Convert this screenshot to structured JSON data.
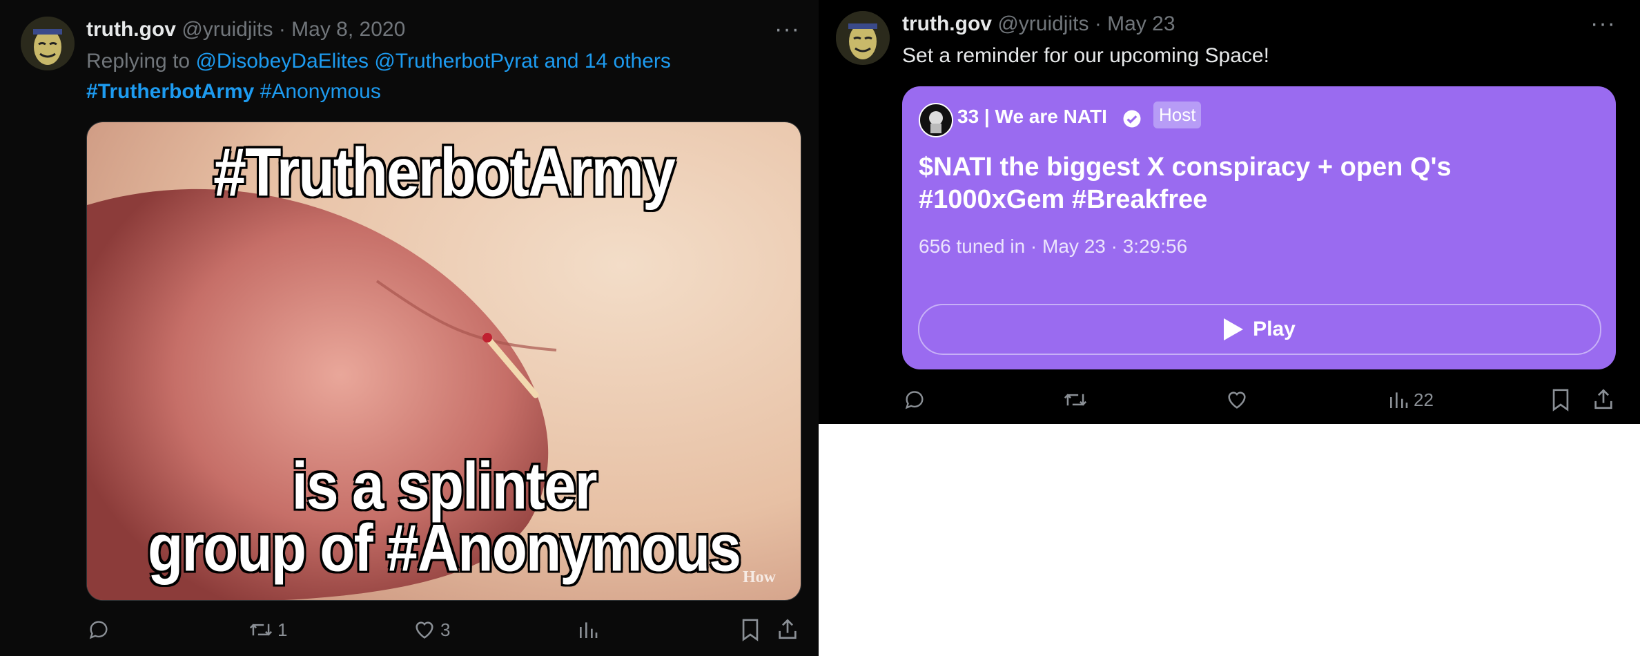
{
  "left_tweet": {
    "display_name": "truth.gov",
    "handle": "@yruidjits",
    "separator": "·",
    "date": "May 8, 2020",
    "replying_prefix": "Replying to",
    "replying_to": [
      "@DisobeyDaElites",
      "@TrutherbotPyrat",
      "and 14 others"
    ],
    "hashtags": [
      "#TrutherbotArmy",
      "#Anonymous"
    ],
    "image": {
      "top_text": "#TrutherbotArmy",
      "bottom_line1": "is a splinter",
      "bottom_line2": "group of #Anonymous",
      "watermark": "How"
    },
    "actions": {
      "reply_count": "",
      "retweet_count": "1",
      "like_count": "3",
      "views_count": ""
    }
  },
  "right_tweet": {
    "display_name": "truth.gov",
    "handle": "@yruidjits",
    "separator": "·",
    "date": "May 23",
    "text": "Set a reminder for our upcoming Space!",
    "space": {
      "host_name": "33 | We are NATI",
      "host_badge": "Host",
      "title_line1": "$NATI the biggest X conspiracy + open Q's",
      "title_line2": "#1000xGem #Breakfree",
      "meta": "656 tuned in · May 23 · 3:29:56",
      "play_label": "Play",
      "card_color": "#9a6bf0"
    },
    "actions": {
      "views_count": "22"
    }
  },
  "colors": {
    "link": "#1d9bf0",
    "muted": "#71767b",
    "text": "#e7e9ea"
  }
}
